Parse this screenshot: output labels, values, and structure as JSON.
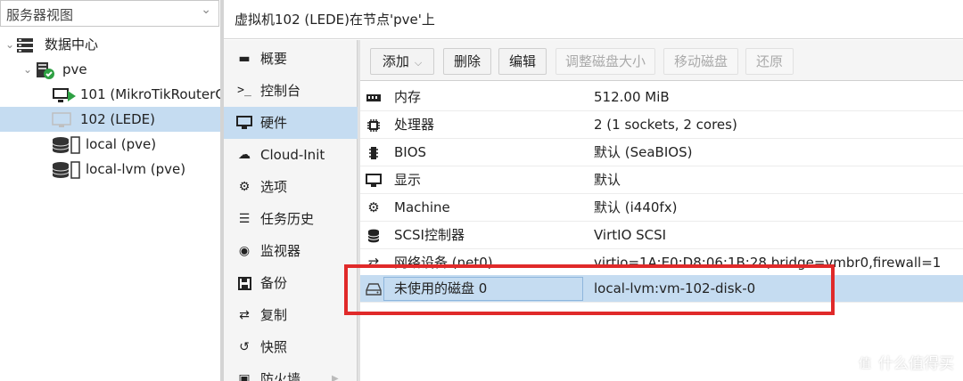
{
  "view_selector": {
    "value": "服务器视图"
  },
  "tree": {
    "datacenter": "数据中心",
    "node": "pve",
    "vms": [
      "101 (MikroTikRouterC",
      "102 (LEDE)"
    ],
    "storages": [
      "local (pve)",
      "local-lvm (pve)"
    ]
  },
  "header": {
    "title": "虚拟机102 (LEDE)在节点'pve'上"
  },
  "nav": {
    "items": [
      {
        "icon": "book-icon",
        "label": "概要"
      },
      {
        "icon": "terminal-icon",
        "label": "控制台"
      },
      {
        "icon": "monitor-icon",
        "label": "硬件"
      },
      {
        "icon": "cloud-icon",
        "label": "Cloud-Init"
      },
      {
        "icon": "gear-icon",
        "label": "选项"
      },
      {
        "icon": "list-icon",
        "label": "任务历史"
      },
      {
        "icon": "eye-icon",
        "label": "监视器"
      },
      {
        "icon": "floppy-icon",
        "label": "备份"
      },
      {
        "icon": "retweet-icon",
        "label": "复制"
      },
      {
        "icon": "history-icon",
        "label": "快照"
      },
      {
        "icon": "shield-icon",
        "label": "防火墙"
      }
    ]
  },
  "toolbar": {
    "add": "添加",
    "remove": "删除",
    "edit": "编辑",
    "resize": "调整磁盘大小",
    "move": "移动磁盘",
    "revert": "还原"
  },
  "hardware": [
    {
      "icon": "memory-icon",
      "key": "内存",
      "value": "512.00 MiB"
    },
    {
      "icon": "cpu-icon",
      "key": "处理器",
      "value": "2 (1 sockets, 2 cores)"
    },
    {
      "icon": "microchip-icon",
      "key": "BIOS",
      "value": "默认 (SeaBIOS)"
    },
    {
      "icon": "desktop-icon",
      "key": "显示",
      "value": "默认"
    },
    {
      "icon": "cogs-icon",
      "key": "Machine",
      "value": "默认 (i440fx)"
    },
    {
      "icon": "database-icon",
      "key": "SCSI控制器",
      "value": "VirtIO SCSI"
    },
    {
      "icon": "network-icon",
      "key": "网络设备 (net0)",
      "value": "virtio=1A:E0:D8:06:1B:28,bridge=vmbr0,firewall=1"
    },
    {
      "icon": "hdd-icon",
      "key": "未使用的磁盘 0",
      "value": "local-lvm:vm-102-disk-0"
    }
  ],
  "watermark": {
    "text": "什么值得买",
    "icon_glyph": "值"
  },
  "colors": {
    "selection": "#c5dcf1",
    "highlight": "#e02a2a",
    "status_green": "#2ea043"
  }
}
